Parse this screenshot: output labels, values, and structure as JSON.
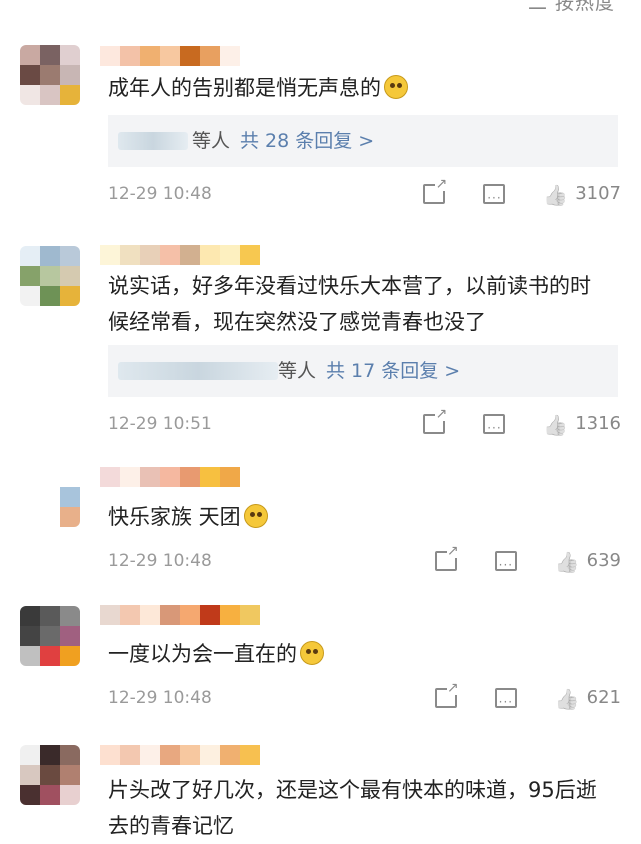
{
  "top": {
    "partial_label": "二 按热度"
  },
  "comments": [
    {
      "avatar_colors": [
        "#c9a9a2",
        "#7a6262",
        "#e0cfd0",
        "#6a4a44",
        "#9b7b70",
        "#c8b6b4",
        "#f0e6e4",
        "#d9c5c3",
        "#e6b33a"
      ],
      "name_colors": [
        "#fde8de",
        "#f3c2a8",
        "#f0b070",
        "#f7c8a0",
        "#c86a20",
        "#e8a060",
        "#fdf0e8"
      ],
      "text": "成年人的告别都是悄无声息的",
      "emoji": "pleading-face",
      "reply_who": "等人",
      "reply_count": "共 28 条回复 >",
      "time": "12-29 10:48",
      "likes": "3107"
    },
    {
      "avatar_colors": [
        "#e5eef5",
        "#9fb9cf",
        "#b9c9d9",
        "#86a26a",
        "#b7c79f",
        "#d5cab0",
        "#f2f2f2",
        "#6e9256",
        "#e6b33a"
      ],
      "name_colors": [
        "#fdf5d8",
        "#f0e0c0",
        "#e8d0b8",
        "#f5c0a8",
        "#d2b090",
        "#fde8b0",
        "#fdf0c0",
        "#f7c850"
      ],
      "text": "说实话，好多年没看过快乐大本营了，以前读书的时候经常看，现在突然没了感觉青春也没了",
      "reply_who": "等人",
      "reply_count": "共 17 条回复 >",
      "time": "12-29 10:51",
      "likes": "1316"
    },
    {
      "avatar_colors": [
        "#ffffff",
        "#ffffff",
        "#ffffff",
        "#ffffff",
        "#ffffff",
        "#a8c4dc",
        "#ffffff",
        "#ffffff",
        "#e8b08a"
      ],
      "name_colors": [
        "#f3dada",
        "#fdf0e8",
        "#e9c1b5",
        "#f5b8a0",
        "#e89a70",
        "#f7c040",
        "#f0a848"
      ],
      "text": "快乐家族 天团",
      "emoji": "crying-face",
      "time": "12-29 10:48",
      "likes": "639"
    },
    {
      "avatar_colors": [
        "#3a3a3a",
        "#5a5a5a",
        "#8a8a8a",
        "#444444",
        "#6a6a6a",
        "#a06080",
        "#c0c0c0",
        "#e04040",
        "#f0a020"
      ],
      "name_colors": [
        "#e8d8d0",
        "#f3c8b0",
        "#fde8d8",
        "#d89878",
        "#f5a870",
        "#c03a1a",
        "#f7b040",
        "#f0c860"
      ],
      "text": "一度以为会一直在的",
      "emoji": "pleading-face",
      "time": "12-29 10:48",
      "likes": "621"
    },
    {
      "avatar_colors": [
        "#f0f0f0",
        "#3a2a2a",
        "#8a6a60",
        "#d8c8c0",
        "#6a4a40",
        "#b08070",
        "#4a3030",
        "#a05060",
        "#e8d0d0"
      ],
      "name_colors": [
        "#fde0d0",
        "#f3c8b0",
        "#fdf0e8",
        "#e8a880",
        "#f7c8a0",
        "#fdf0e0",
        "#f0b070",
        "#f7c050"
      ],
      "text": "片头改了好几次，还是这个最有快本的味道，95后逝去的青春记忆"
    }
  ]
}
